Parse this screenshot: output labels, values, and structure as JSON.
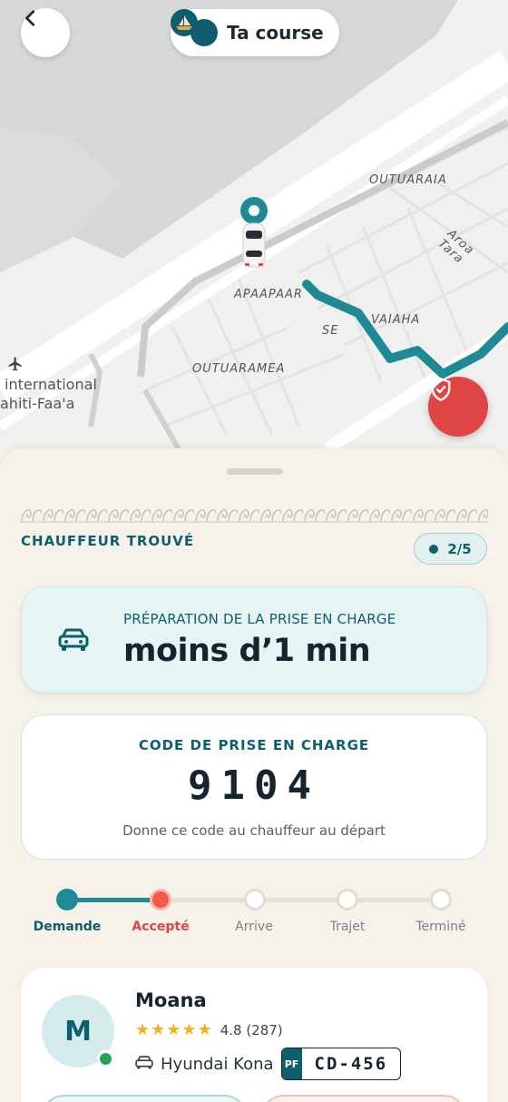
{
  "header": {
    "title": "Ta course"
  },
  "map": {
    "labels": {
      "outuaraia": "OUTUARAIA",
      "aroa": "Aroa Tara",
      "apaapaar": "APAAPAAR",
      "vaiaha": "VAIAHA",
      "se": "SE",
      "outuaramea": "OUTUARAMEA",
      "airport_line1": "international",
      "airport_line2": "ahiti-Faa'a"
    }
  },
  "status": {
    "title": "CHAUFFEUR TROUVÉ",
    "step": "2/5"
  },
  "eta": {
    "label": "PRÉPARATION DE LA PRISE EN CHARGE",
    "value": "moins d’1 min"
  },
  "pickup_code": {
    "label": "CODE DE PRISE EN CHARGE",
    "code": "9104",
    "hint": "Donne ce code au chauffeur au départ"
  },
  "progress": {
    "steps": [
      {
        "label": "Demande",
        "state": "done"
      },
      {
        "label": "Accepté",
        "state": "current"
      },
      {
        "label": "Arrive",
        "state": "pending"
      },
      {
        "label": "Trajet",
        "state": "pending"
      },
      {
        "label": "Terminé",
        "state": "pending"
      }
    ]
  },
  "driver": {
    "initial": "M",
    "name": "Moana",
    "rating": "4.8 (287)",
    "vehicle": "Hyundai Kona",
    "plate_country": "PF",
    "plate_number": "CD-456"
  },
  "colors": {
    "brand_teal": "#0e5f6e",
    "route_teal": "#1e8a94",
    "accent_red": "#e04545",
    "online_green": "#22a55a",
    "star_yellow": "#f2b11e"
  },
  "icons": {
    "back": "chevron-left-icon",
    "logo": "boat-logo-icon",
    "car_marker": "car-marker-icon",
    "sos": "shield-check-icon",
    "eta_car": "car-icon",
    "vehicle": "car-icon",
    "airport": "airplane-icon"
  }
}
